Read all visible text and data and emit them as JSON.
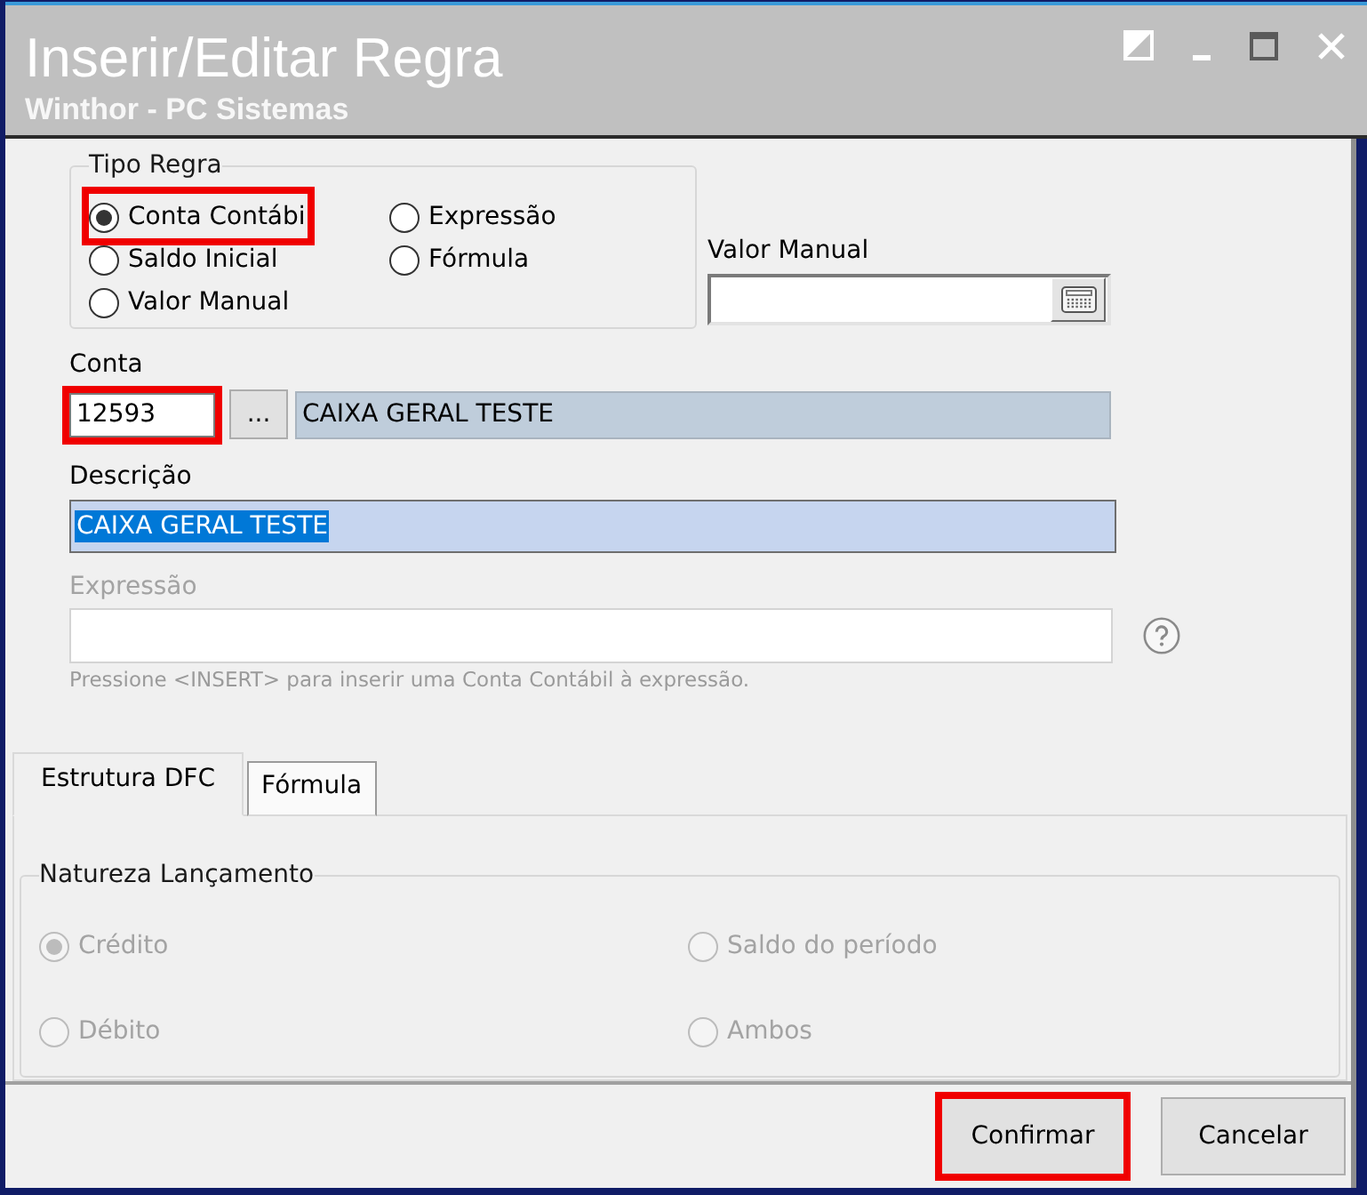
{
  "window": {
    "title": "Inserir/Editar Regra",
    "subtitle": "Winthor - PC Sistemas"
  },
  "tipo_regra": {
    "legend": "Tipo Regra",
    "options": [
      {
        "label": "Conta Contábi",
        "selected": true,
        "highlighted": true
      },
      {
        "label": "Saldo Inicial",
        "selected": false,
        "highlighted": false
      },
      {
        "label": "Valor Manual",
        "selected": false,
        "highlighted": false
      },
      {
        "label": "Expressão",
        "selected": false,
        "highlighted": false
      },
      {
        "label": "Fórmula",
        "selected": false,
        "highlighted": false
      }
    ]
  },
  "valor_manual": {
    "label": "Valor Manual"
  },
  "conta": {
    "label": "Conta",
    "code": "12593",
    "code_highlighted": true,
    "lookup_button": "...",
    "name": "CAIXA GERAL TESTE"
  },
  "descricao": {
    "label": "Descrição",
    "value": "CAIXA GERAL TESTE",
    "text_selected": true
  },
  "expressao": {
    "label": "Expressão",
    "disabled": true,
    "hint": "Pressione <INSERT> para inserir uma Conta Contábil à expressão."
  },
  "tabs": [
    {
      "label": "Estrutura DFC",
      "selected": true
    },
    {
      "label": "Fórmula",
      "selected": false
    }
  ],
  "natureza_lancamento": {
    "legend": "Natureza Lançamento",
    "disabled": true,
    "options": [
      {
        "label": "Crédito",
        "selected": true
      },
      {
        "label": "Débito",
        "selected": false
      },
      {
        "label": "Saldo do período",
        "selected": false
      },
      {
        "label": "Ambos",
        "selected": false
      }
    ]
  },
  "buttons": [
    {
      "label": "Confirmar",
      "highlighted": true
    },
    {
      "label": "Cancelar",
      "highlighted": false
    }
  ]
}
